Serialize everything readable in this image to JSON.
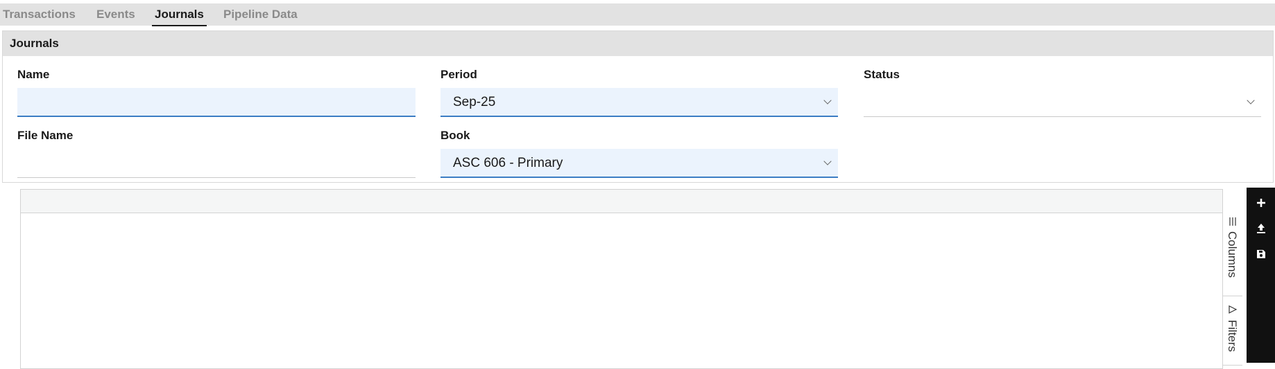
{
  "tabs": [
    {
      "label": "Transactions",
      "active": false
    },
    {
      "label": "Events",
      "active": false
    },
    {
      "label": "Journals",
      "active": true
    },
    {
      "label": "Pipeline Data",
      "active": false
    }
  ],
  "panel": {
    "title": "Journals",
    "fields": {
      "name": {
        "label": "Name",
        "value": ""
      },
      "period": {
        "label": "Period",
        "value": "Sep-25"
      },
      "status": {
        "label": "Status",
        "value": ""
      },
      "file_name": {
        "label": "File Name",
        "value": ""
      },
      "book": {
        "label": "Book",
        "value": "ASC 606 - Primary"
      }
    }
  },
  "side_panel": {
    "columns_label": "Columns",
    "filters_label": "Filters"
  },
  "toolbar": {
    "icons": [
      "plus-icon",
      "upload-icon",
      "save-icon"
    ]
  },
  "colors": {
    "tab_bar": "#e2e2e2",
    "field_fill": "#ebf3fd",
    "field_accent": "#3b7dc4",
    "toolbar": "#111111"
  }
}
